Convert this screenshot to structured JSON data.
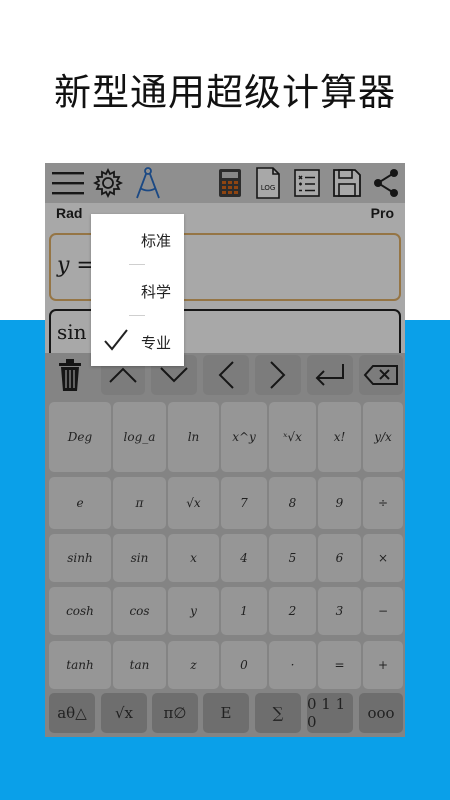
{
  "headline": "新型通用超级计算器",
  "toolbar": {
    "icons": [
      "menu-icon",
      "gear-icon",
      "compass-icon",
      "calculator-icon",
      "log-icon",
      "list-icon",
      "save-icon",
      "share-icon"
    ],
    "log_label": "LOG"
  },
  "mode": {
    "angle": "Rad",
    "level": "Pro"
  },
  "expression": "y =",
  "result": "sin (",
  "menu": {
    "items": [
      {
        "label": "标准",
        "checked": false
      },
      {
        "label": "科学",
        "checked": false
      },
      {
        "label": "专业",
        "checked": true
      }
    ]
  },
  "keys": {
    "row1": [
      "Deg",
      "log_a",
      "ln",
      "x^y",
      "ˣ√x",
      "x!",
      "y/x"
    ],
    "row2": [
      "e",
      "π",
      "√x",
      "7",
      "8",
      "9",
      "÷"
    ],
    "row3": [
      "sinh",
      "sin",
      "x",
      "4",
      "5",
      "6",
      "×"
    ],
    "row4": [
      "cosh",
      "cos",
      "y",
      "1",
      "2",
      "3",
      "−"
    ],
    "row5": [
      "tanh",
      "tan",
      "z",
      "0",
      "·",
      "=",
      "+"
    ],
    "bottom": [
      "aθ△",
      "√x",
      "π∅",
      "E",
      "∑",
      "0 1 1 0",
      "ooo"
    ]
  },
  "colors": {
    "accent_blue": "#0aa0e9",
    "expr_border": "#e3b26a"
  }
}
